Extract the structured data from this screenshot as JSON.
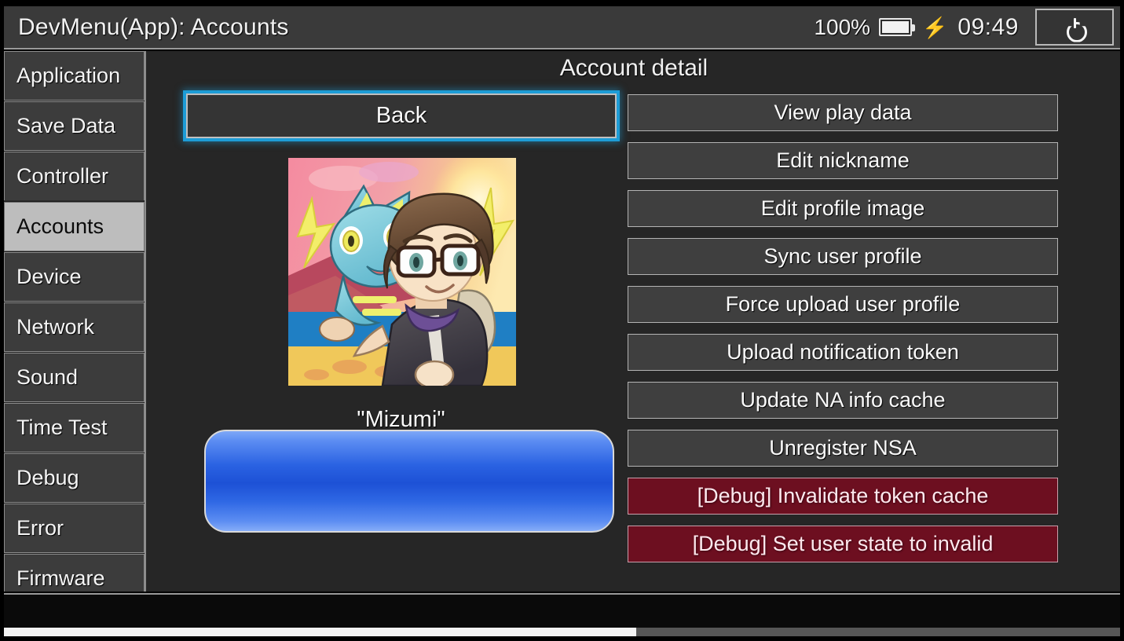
{
  "titlebar": {
    "title": "DevMenu(App): Accounts",
    "battery_percent": "100%",
    "battery_icon": "battery-full-icon",
    "charging_icon": "lightning-bolt-icon",
    "clock": "09:49",
    "power_icon": "power-icon"
  },
  "sidebar": {
    "items": [
      {
        "label": "Application",
        "selected": false
      },
      {
        "label": "Save Data",
        "selected": false
      },
      {
        "label": "Controller",
        "selected": false
      },
      {
        "label": "Accounts",
        "selected": true
      },
      {
        "label": "Device",
        "selected": false
      },
      {
        "label": "Network",
        "selected": false
      },
      {
        "label": "Sound",
        "selected": false
      },
      {
        "label": "Time Test",
        "selected": false
      },
      {
        "label": "Debug",
        "selected": false
      },
      {
        "label": "Error",
        "selected": false
      },
      {
        "label": "Firmware",
        "selected": false
      }
    ]
  },
  "content": {
    "detail_title": "Account detail",
    "back_label": "Back",
    "nickname": "\"Mizumi\"",
    "avatar_alt": "user-profile-image",
    "actions": [
      {
        "label": "View play data",
        "style": "normal"
      },
      {
        "label": "Edit nickname",
        "style": "normal"
      },
      {
        "label": "Edit profile image",
        "style": "normal"
      },
      {
        "label": "Sync user profile",
        "style": "normal"
      },
      {
        "label": "Force upload user profile",
        "style": "normal"
      },
      {
        "label": "Upload notification token",
        "style": "normal"
      },
      {
        "label": "Update NA info cache",
        "style": "normal"
      },
      {
        "label": "Unregister NSA",
        "style": "normal"
      },
      {
        "label": "[Debug] Invalidate token cache",
        "style": "danger"
      },
      {
        "label": "[Debug] Set user state to invalid",
        "style": "danger"
      }
    ]
  },
  "colors": {
    "focus_ring": "#1d9cd6",
    "danger_bg": "#6d0f20",
    "selected_bg": "#bdbdbd",
    "panel_bg": "#262626",
    "button_bg": "#3f3f3f"
  }
}
